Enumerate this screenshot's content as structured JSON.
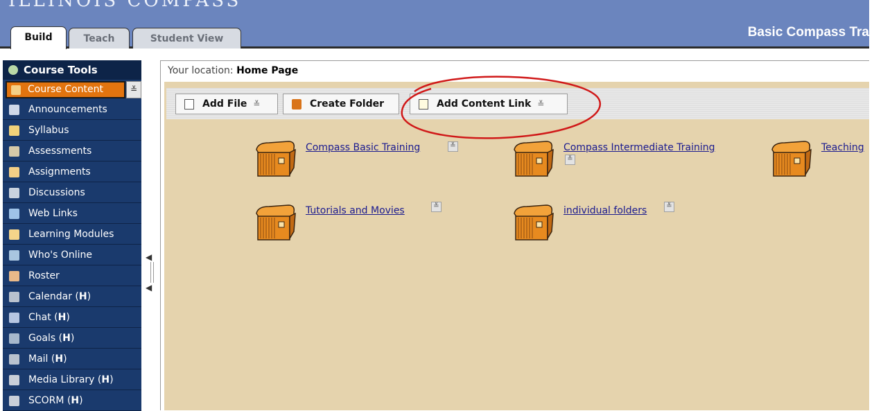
{
  "header": {
    "brand": "ILLINOIS COMPASS",
    "course_title": "Basic Compass Tra",
    "tabs": [
      {
        "label": "Build"
      },
      {
        "label": "Teach"
      },
      {
        "label": "Student View"
      }
    ]
  },
  "sidebar": {
    "header": "Course Tools",
    "active_item": "Course Content",
    "menu_symbol": "≚",
    "items": [
      {
        "label": "Announcements",
        "suffix": "",
        "icon": "announcements-icon"
      },
      {
        "label": "Syllabus",
        "suffix": "",
        "icon": "syllabus-icon"
      },
      {
        "label": "Assessments",
        "suffix": "",
        "icon": "assessments-icon"
      },
      {
        "label": "Assignments",
        "suffix": "",
        "icon": "assignments-icon"
      },
      {
        "label": "Discussions",
        "suffix": "",
        "icon": "discussions-icon"
      },
      {
        "label": "Web Links",
        "suffix": "",
        "icon": "web-links-icon"
      },
      {
        "label": "Learning Modules",
        "suffix": "",
        "icon": "learning-modules-icon"
      },
      {
        "label": "Who's Online",
        "suffix": "",
        "icon": "whos-online-icon"
      },
      {
        "label": "Roster",
        "suffix": "",
        "icon": "roster-icon"
      },
      {
        "label": "Calendar",
        "suffix": "H",
        "icon": "calendar-icon"
      },
      {
        "label": "Chat",
        "suffix": "H",
        "icon": "chat-icon"
      },
      {
        "label": "Goals",
        "suffix": "H",
        "icon": "goals-icon"
      },
      {
        "label": "Mail",
        "suffix": "H",
        "icon": "mail-icon"
      },
      {
        "label": "Media Library",
        "suffix": "H",
        "icon": "media-library-icon"
      },
      {
        "label": "SCORM",
        "suffix": "H",
        "icon": "scorm-icon"
      }
    ]
  },
  "location": {
    "prefix": "Your location:",
    "page": "Home Page"
  },
  "actions": {
    "add_file": "Add File",
    "create_folder": "Create Folder",
    "add_content_link": "Add Content Link",
    "menu_symbol": "≚"
  },
  "folders": [
    {
      "label": "Compass Basic Training"
    },
    {
      "label": "Compass Intermediate Training"
    },
    {
      "label": "Teaching"
    },
    {
      "label": "Tutorials and Movies"
    },
    {
      "label": "individual folders"
    }
  ],
  "colors": {
    "header_bg": "#6b85be",
    "sidebar_bg": "#1a3a6d",
    "active_item_bg": "#e2740f",
    "content_bg": "#e5d3ad",
    "highlight": "#d01919"
  }
}
